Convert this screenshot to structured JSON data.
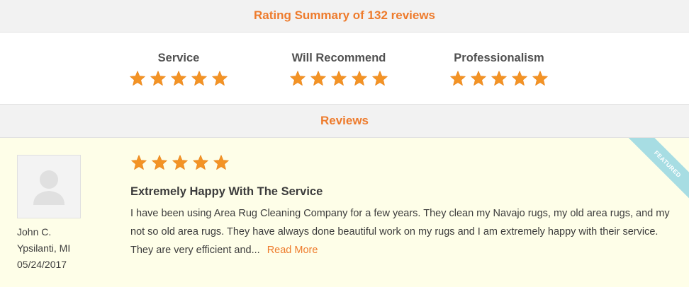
{
  "summary": {
    "title": "Rating Summary of 132 reviews",
    "categories": [
      {
        "label": "Service",
        "stars": 5
      },
      {
        "label": "Will Recommend",
        "stars": 5
      },
      {
        "label": "Professionalism",
        "stars": 5
      }
    ]
  },
  "reviews_header": "Reviews",
  "review": {
    "badge": "FEATURED",
    "stars": 5,
    "title": "Extremely Happy With The Service",
    "body": "I have been using Area Rug Cleaning Company for a few years. They clean my Navajo rugs, my old area rugs, and my not so old area rugs. They have always done beautiful work on my rugs and I am extremely happy with their service. They are very efficient and...",
    "read_more": "Read More",
    "reviewer_name": "John C.",
    "reviewer_location": "Ypsilanti, MI",
    "review_date": "05/24/2017",
    "avatar_icon": "user-silhouette-icon"
  },
  "colors": {
    "accent": "#ee7b2c",
    "star": "#f39325",
    "review_bg": "#fefee8",
    "ribbon": "#a7dde3"
  }
}
